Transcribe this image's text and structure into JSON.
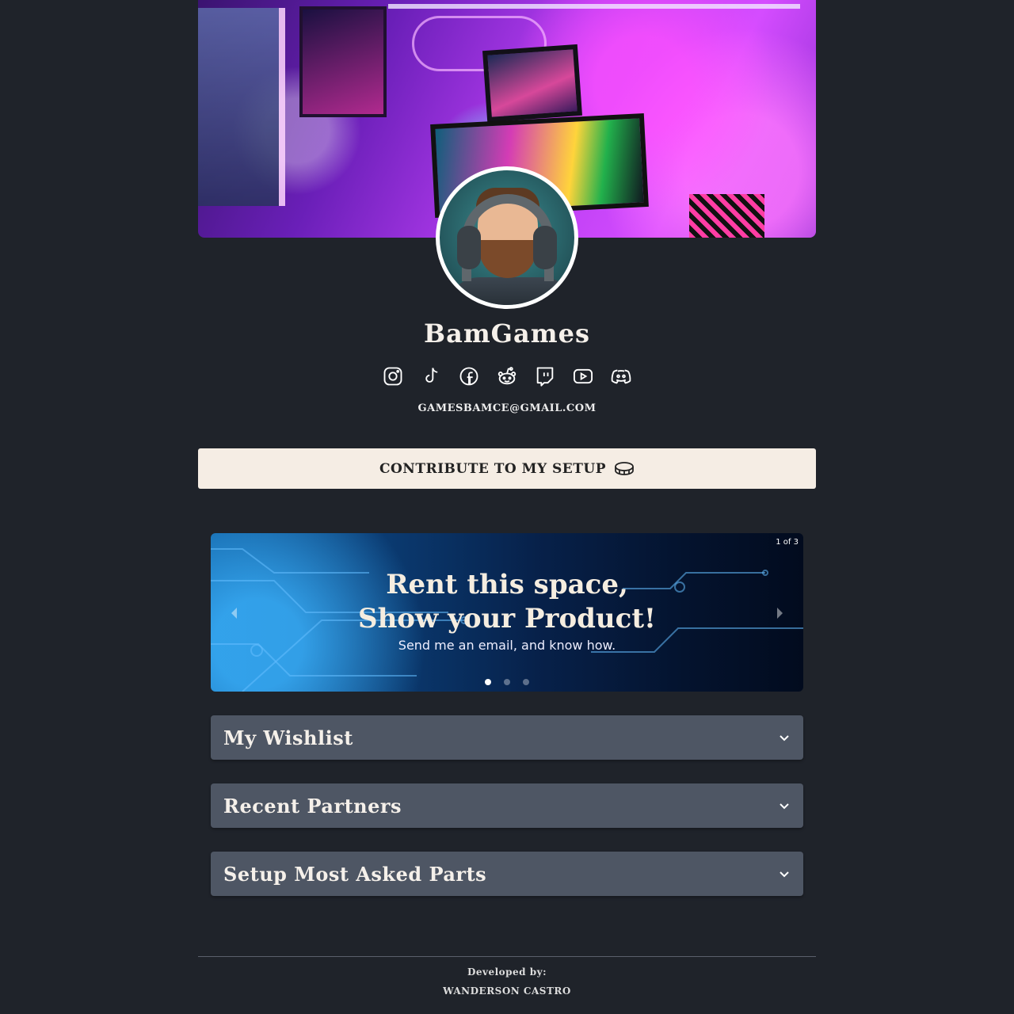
{
  "profile": {
    "name": "BamGames",
    "email": "GAMESBAMCE@GMAIL.COM"
  },
  "socials": [
    {
      "icon": "instagram-icon"
    },
    {
      "icon": "tiktok-icon"
    },
    {
      "icon": "facebook-icon"
    },
    {
      "icon": "reddit-icon"
    },
    {
      "icon": "twitch-icon"
    },
    {
      "icon": "youtube-icon"
    },
    {
      "icon": "discord-icon"
    }
  ],
  "contribute": {
    "label": "CONTRIBUTE TO MY SETUP",
    "icon": "coin-icon"
  },
  "carousel": {
    "counter": "1 of 3",
    "title_line1": "Rent this space,",
    "title_line2": "Show your Product!",
    "subtitle": "Send me an email, and know how.",
    "active_slide": 1,
    "slide_count": 3
  },
  "sections": {
    "wishlist": "My Wishlist",
    "partners": "Recent Partners",
    "parts": "Setup Most Asked Parts"
  },
  "footer": {
    "developed_by": "Developed by:",
    "author": "WANDERSON CASTRO"
  },
  "colors": {
    "background": "#1f232a",
    "button_bg": "#f5ede4",
    "accordion_bg": "#4e5664"
  }
}
